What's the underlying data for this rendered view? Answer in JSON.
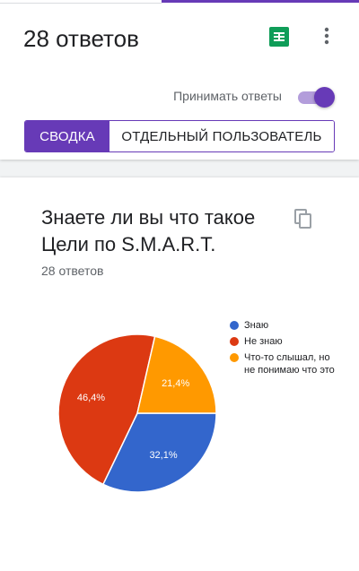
{
  "header": {
    "title": "28 ответов",
    "accept_label": "Принимать ответы",
    "accept_on": true
  },
  "tabs": [
    {
      "label": "СВОДКА",
      "active": true
    },
    {
      "label": "ОТДЕЛЬНЫЙ ПОЛЬЗОВАТЕЛЬ",
      "active": false
    }
  ],
  "icons": {
    "sheets": "google-sheets-icon",
    "more": "more-vert-icon",
    "copy": "copy-icon"
  },
  "colors": {
    "accent": "#673ab7",
    "accent_light": "#b39ddb",
    "sheets": "#0f9d58"
  },
  "question": {
    "title": "Знаете ли вы что такое Цели по S.M.A.R.T.",
    "count": "28 ответов"
  },
  "chart_data": {
    "type": "pie",
    "categories": [
      "Знаю",
      "Не знаю",
      "Что-то слышал, но не понимаю что это"
    ],
    "values": [
      32.1,
      46.4,
      21.4
    ],
    "labels": [
      "32,1%",
      "46,4%",
      "21,4%"
    ],
    "colors": [
      "#3366cc",
      "#dc3912",
      "#ff9900"
    ],
    "legend": "right"
  }
}
